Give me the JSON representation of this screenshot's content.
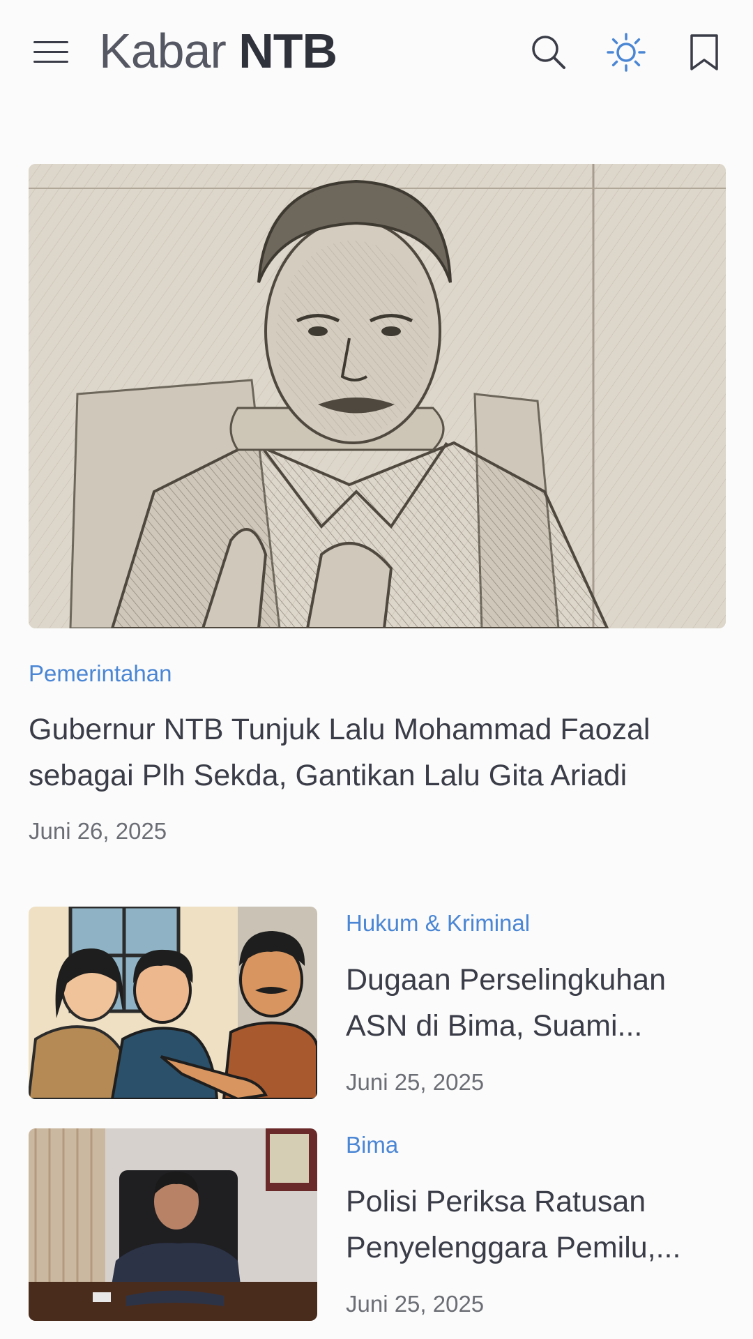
{
  "header": {
    "brand_light": "Kabar",
    "brand_bold": "NTB",
    "icons": [
      "menu-icon",
      "search-icon",
      "sun-icon",
      "bookmark-icon"
    ]
  },
  "featured": {
    "category": "Pemerintahan",
    "title": "Gubernur NTB Tunjuk Lalu Mohammad Faozal sebagai Plh Sekda, Gantikan Lalu Gita Ariadi",
    "date": "Juni 26, 2025"
  },
  "articles": [
    {
      "category": "Hukum & Kriminal",
      "title": "Dugaan Perselingkuhan ASN di Bima, Suami...",
      "date": "Juni 25, 2025"
    },
    {
      "category": "Bima",
      "title": "Polisi Periksa Ratusan Penyelenggara Pemilu,...",
      "date": "Juni 25, 2025"
    }
  ],
  "colors": {
    "accent": "#4a86d4",
    "text": "#3a3c47",
    "muted": "#6c6e76",
    "background": "#fbfbfb"
  }
}
